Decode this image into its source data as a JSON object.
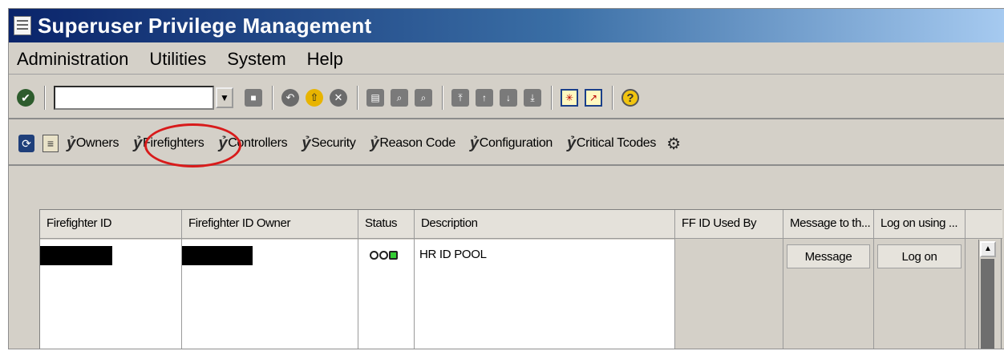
{
  "window": {
    "title": "Superuser Privilege Management"
  },
  "menu": [
    "Administration",
    "Utilities",
    "System",
    "Help"
  ],
  "toolbar": {
    "command_field_value": ""
  },
  "app_toolbar": {
    "buttons": [
      "Owners",
      "Firefighters",
      "Controllers",
      "Security",
      "Reason Code",
      "Configuration",
      "Critical Tcodes"
    ]
  },
  "table": {
    "columns": [
      "Firefighter ID",
      "Firefighter ID Owner",
      "Status",
      "Description",
      "FF ID Used By",
      "Message to th...",
      "Log on using ..."
    ],
    "rows": [
      {
        "firefighter_id": "",
        "owner": "",
        "status": "green",
        "description": "HR ID POOL",
        "used_by": "",
        "message_btn": "Message",
        "logon_btn": "Log on"
      }
    ]
  },
  "colors": {
    "title_bar_start": "#0a246a",
    "title_bar_end": "#a6caf0",
    "highlight_circle": "#d81b1b",
    "background": "#d4d0c8"
  }
}
